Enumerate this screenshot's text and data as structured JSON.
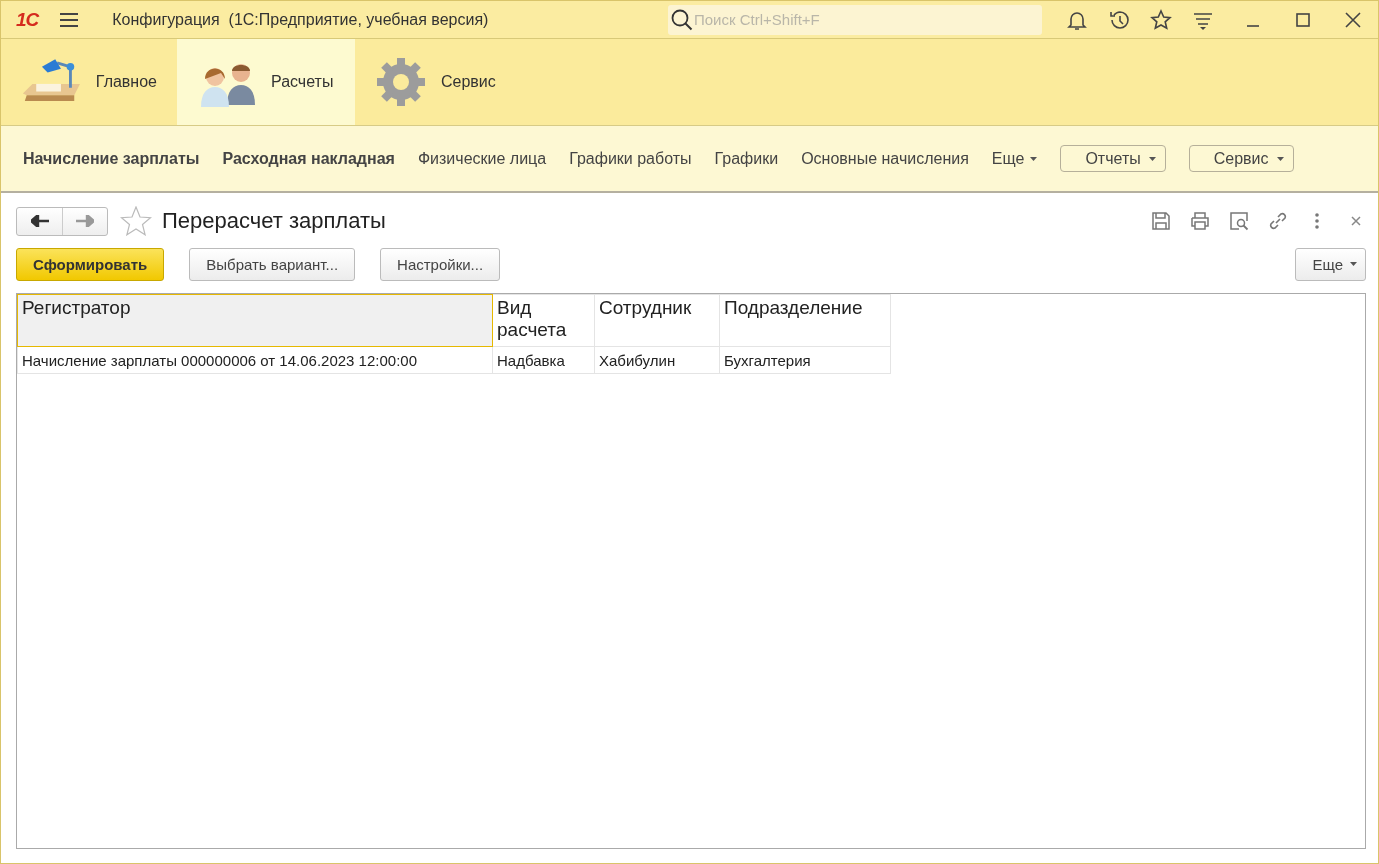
{
  "window": {
    "logo": "1С",
    "title": "Конфигурация  (1С:Предприятие, учебная версия)",
    "search": {
      "placeholder": "Поиск Ctrl+Shift+F"
    }
  },
  "sections": [
    {
      "label": "Главное",
      "selected": false
    },
    {
      "label": "Расчеты",
      "selected": true
    },
    {
      "label": "Сервис",
      "selected": false
    }
  ],
  "nav": {
    "links": [
      {
        "label": "Начисление зарплаты",
        "emphasized": true
      },
      {
        "label": "Расходная накладная",
        "emphasized": true
      },
      {
        "label": "Физические лица",
        "emphasized": false
      },
      {
        "label": "Графики работы",
        "emphasized": false
      },
      {
        "label": "Графики",
        "emphasized": false
      },
      {
        "label": "Основные начисления",
        "emphasized": false
      }
    ],
    "more": "Еще",
    "menus": [
      "Отчеты",
      "Сервис"
    ]
  },
  "form": {
    "title": "Перерасчет зарплаты",
    "favorite": false,
    "buttons": [
      {
        "label": "Сформировать",
        "kind": "default"
      },
      {
        "label": "Выбрать вариант...",
        "kind": "plain"
      },
      {
        "label": "Настройки...",
        "kind": "plain"
      }
    ],
    "more": "Еще",
    "table": {
      "columns": [
        {
          "label": "Регистратор",
          "selected": true
        },
        {
          "label": "Вид расчета",
          "selected": false
        },
        {
          "label": "Сотрудник",
          "selected": false
        },
        {
          "label": "Подразделение",
          "selected": false
        }
      ],
      "rows": [
        [
          "Начисление зарплаты 000000006 от 14.06.2023 12:00:00",
          "Надбавка",
          "Хабибулин",
          "Бухгалтерия"
        ]
      ]
    }
  }
}
